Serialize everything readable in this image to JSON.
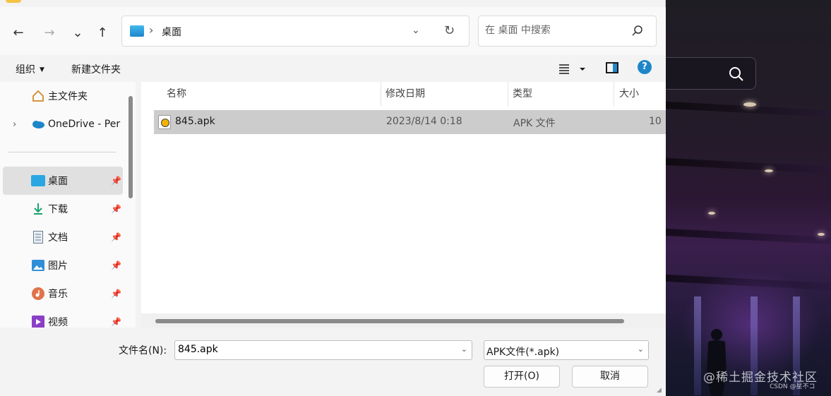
{
  "nav": {
    "back": "←",
    "forward": "→",
    "recent": "⌄",
    "up": "↑",
    "address_crumb": "桌面",
    "search_placeholder": "在 桌面 中搜索"
  },
  "toolbar": {
    "organize_label": "组织",
    "new_folder_label": "新建文件夹"
  },
  "sidebar": {
    "items": [
      {
        "label": "主文件夹",
        "icon": "home-icon",
        "pinned": false
      },
      {
        "label": "OneDrive - Per",
        "icon": "cloud-icon",
        "pinned": false
      },
      {
        "label": "桌面",
        "icon": "desktop-icon",
        "pinned": true,
        "selected": true
      },
      {
        "label": "下载",
        "icon": "download-icon",
        "pinned": true
      },
      {
        "label": "文档",
        "icon": "document-icon",
        "pinned": true
      },
      {
        "label": "图片",
        "icon": "pictures-icon",
        "pinned": true
      },
      {
        "label": "音乐",
        "icon": "music-icon",
        "pinned": true
      },
      {
        "label": "视频",
        "icon": "video-icon",
        "pinned": true
      }
    ]
  },
  "columns": {
    "name": "名称",
    "modified": "修改日期",
    "type": "类型",
    "size": "大小"
  },
  "files": [
    {
      "name": "845.apk",
      "modified": "2023/8/14 0:18",
      "type": "APK 文件",
      "size": "10"
    }
  ],
  "bottom": {
    "filename_label": "文件名(N):",
    "filename_value": "845.apk",
    "filetype_value": "APK文件(*.apk)",
    "open_label": "打开(O)",
    "cancel_label": "取消"
  },
  "watermark": {
    "text": "@稀土掘金技术社区",
    "small": "CSDN @星不コ"
  },
  "colors": {
    "accent": "#1e86c9",
    "selection": "#cccccc"
  }
}
